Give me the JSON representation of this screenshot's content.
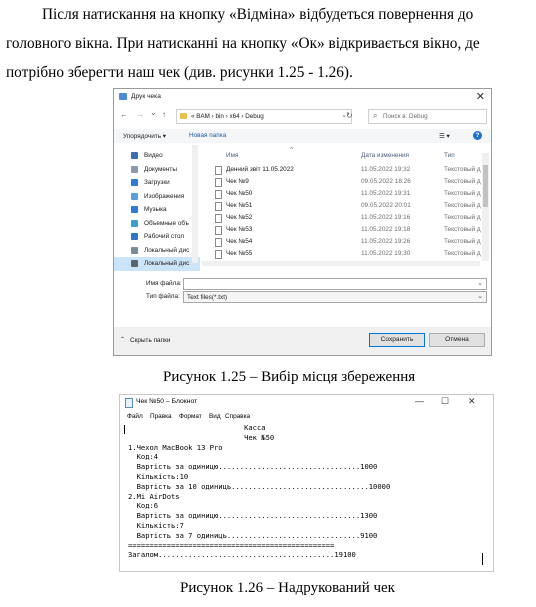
{
  "paragraph": {
    "lines": [
      "Після натискання на кнопку «Відміна» відбудеться повернення до",
      "головного вікна. При натисканні на кнопку «Ок» відкривається вікно, де",
      "потрібно зберегти наш чек (див. рисунки 1.25 - 1.26)."
    ]
  },
  "save_dialog": {
    "title": "Друк чека",
    "close_glyph": "✕",
    "nav": {
      "back": "←",
      "forward": "→",
      "up_dropdown": "⌄",
      "up": "↑",
      "refresh": "↻"
    },
    "address": {
      "text": "«  BAM  ›  bin  ›  x64  ›  Debug",
      "chevron": "⌄"
    },
    "search": {
      "icon": "⌕",
      "placeholder": "Поиск в: Debug"
    },
    "commands": {
      "organize": "Упорядочить ▾",
      "new_folder": "Новая папка",
      "view": "☰ ▾",
      "help": "?"
    },
    "sidebar": [
      {
        "label": "Видео",
        "color": "#3a6fb0"
      },
      {
        "label": "Документы",
        "color": "#8a9ab0"
      },
      {
        "label": "Загрузки",
        "color": "#2e7bd6"
      },
      {
        "label": "Изображения",
        "color": "#5aa0d8"
      },
      {
        "label": "Музыка",
        "color": "#2e7bd6"
      },
      {
        "label": "Объемные объ",
        "color": "#3aa0d0"
      },
      {
        "label": "Рабочий стол",
        "color": "#2f74c8"
      },
      {
        "label": "Локальный дис",
        "color": "#7a8a9a"
      },
      {
        "label": "Локальный дис",
        "color": "#5a6470"
      }
    ],
    "columns": {
      "name": "Имя",
      "date": "Дата изменения",
      "type": "Тип",
      "sort_glyph": "^"
    },
    "files": [
      {
        "name": "Денний звіт 11.05.2022",
        "date": "11.05.2022 19:32",
        "type": "Текстовый д"
      },
      {
        "name": "Чек №9",
        "date": "09.05.2022 18:26",
        "type": "Текстовый д"
      },
      {
        "name": "Чек №50",
        "date": "11.05.2022 19:31",
        "type": "Текстовый д"
      },
      {
        "name": "Чек №51",
        "date": "09.05.2022 20:01",
        "type": "Текстовый д"
      },
      {
        "name": "Чек №52",
        "date": "11.05.2022 19:16",
        "type": "Текстовый д"
      },
      {
        "name": "Чек №53",
        "date": "11.05.2022 19:18",
        "type": "Текстовый д"
      },
      {
        "name": "Чек №54",
        "date": "11.05.2022 19:26",
        "type": "Текстовый д"
      },
      {
        "name": "Чек №55",
        "date": "11.05.2022 19:30",
        "type": "Текстовый д"
      }
    ],
    "filename_label": "Имя файла:",
    "filename_value": "",
    "filetype_label": "Тип файла:",
    "filetype_value": "Text files(*.txt)",
    "hide_folders": "Скрыть папки",
    "save_button": "Сохранить",
    "cancel_button": "Отмена"
  },
  "caption1": "Рисунок 1.25 – Вибір місця збереження",
  "notepad": {
    "title": "Чек №50 – Блокнот",
    "controls": {
      "minimize": "—",
      "maximize": "☐",
      "close": "✕"
    },
    "menu": [
      "Файл",
      "Правка",
      "Формат",
      "Вид",
      "Справка"
    ],
    "lines": [
      "                           Касса",
      "                           Чек №50",
      "1.Чехол MacBook 13 Pro",
      "  Код:4",
      "  Вартість за одиницю.................................1000",
      "  Кількість:10",
      "  Вартість за 10 одиниць................................10000",
      "2.Mi AirDots",
      "  Код:6",
      "  Вартість за одиницю.................................1300",
      "  Кількість:7",
      "  Вартість за 7 одиниць...............................9100",
      "================================================",
      "Загалом.........................................19100"
    ]
  },
  "caption2": "Рисунок 1.26 – Надрукований чек"
}
